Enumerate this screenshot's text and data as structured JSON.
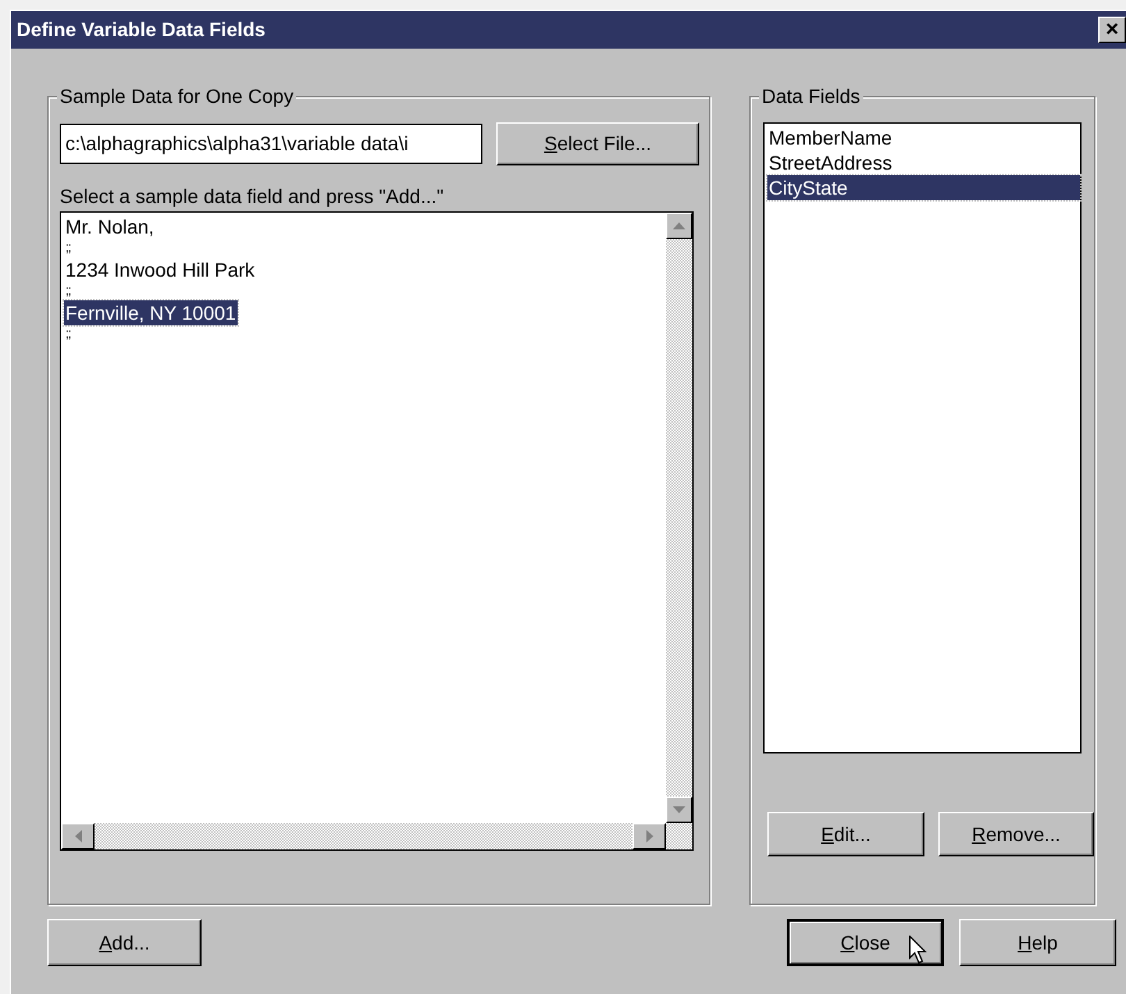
{
  "window": {
    "title": "Define Variable Data Fields",
    "close_glyph": "×"
  },
  "sample_group": {
    "title": "Sample Data for One Copy",
    "file_path": "c:\\alphagraphics\\alpha31\\variable data\\i",
    "select_button": "Select File...",
    "instruction": "Select a sample data field and press \"Add...\"",
    "lines": [
      {
        "text": "Mr. Nolan,",
        "kind": "text",
        "selected": false
      },
      {
        "text": ";;",
        "kind": "separator",
        "selected": false
      },
      {
        "text": "1234 Inwood Hill Park",
        "kind": "text",
        "selected": false
      },
      {
        "text": ";;",
        "kind": "separator",
        "selected": false
      },
      {
        "text": "Fernville, NY 10001",
        "kind": "text",
        "selected": true
      },
      {
        "text": ";;",
        "kind": "separator",
        "selected": false
      }
    ]
  },
  "fields_group": {
    "title": "Data Fields",
    "items": [
      {
        "label": "MemberName",
        "selected": false
      },
      {
        "label": "StreetAddress",
        "selected": false
      },
      {
        "label": "CityState",
        "selected": true
      }
    ],
    "edit_button": "Edit...",
    "remove_button": "Remove..."
  },
  "buttons": {
    "add": "Add...",
    "close": "Close",
    "help": "Help"
  }
}
